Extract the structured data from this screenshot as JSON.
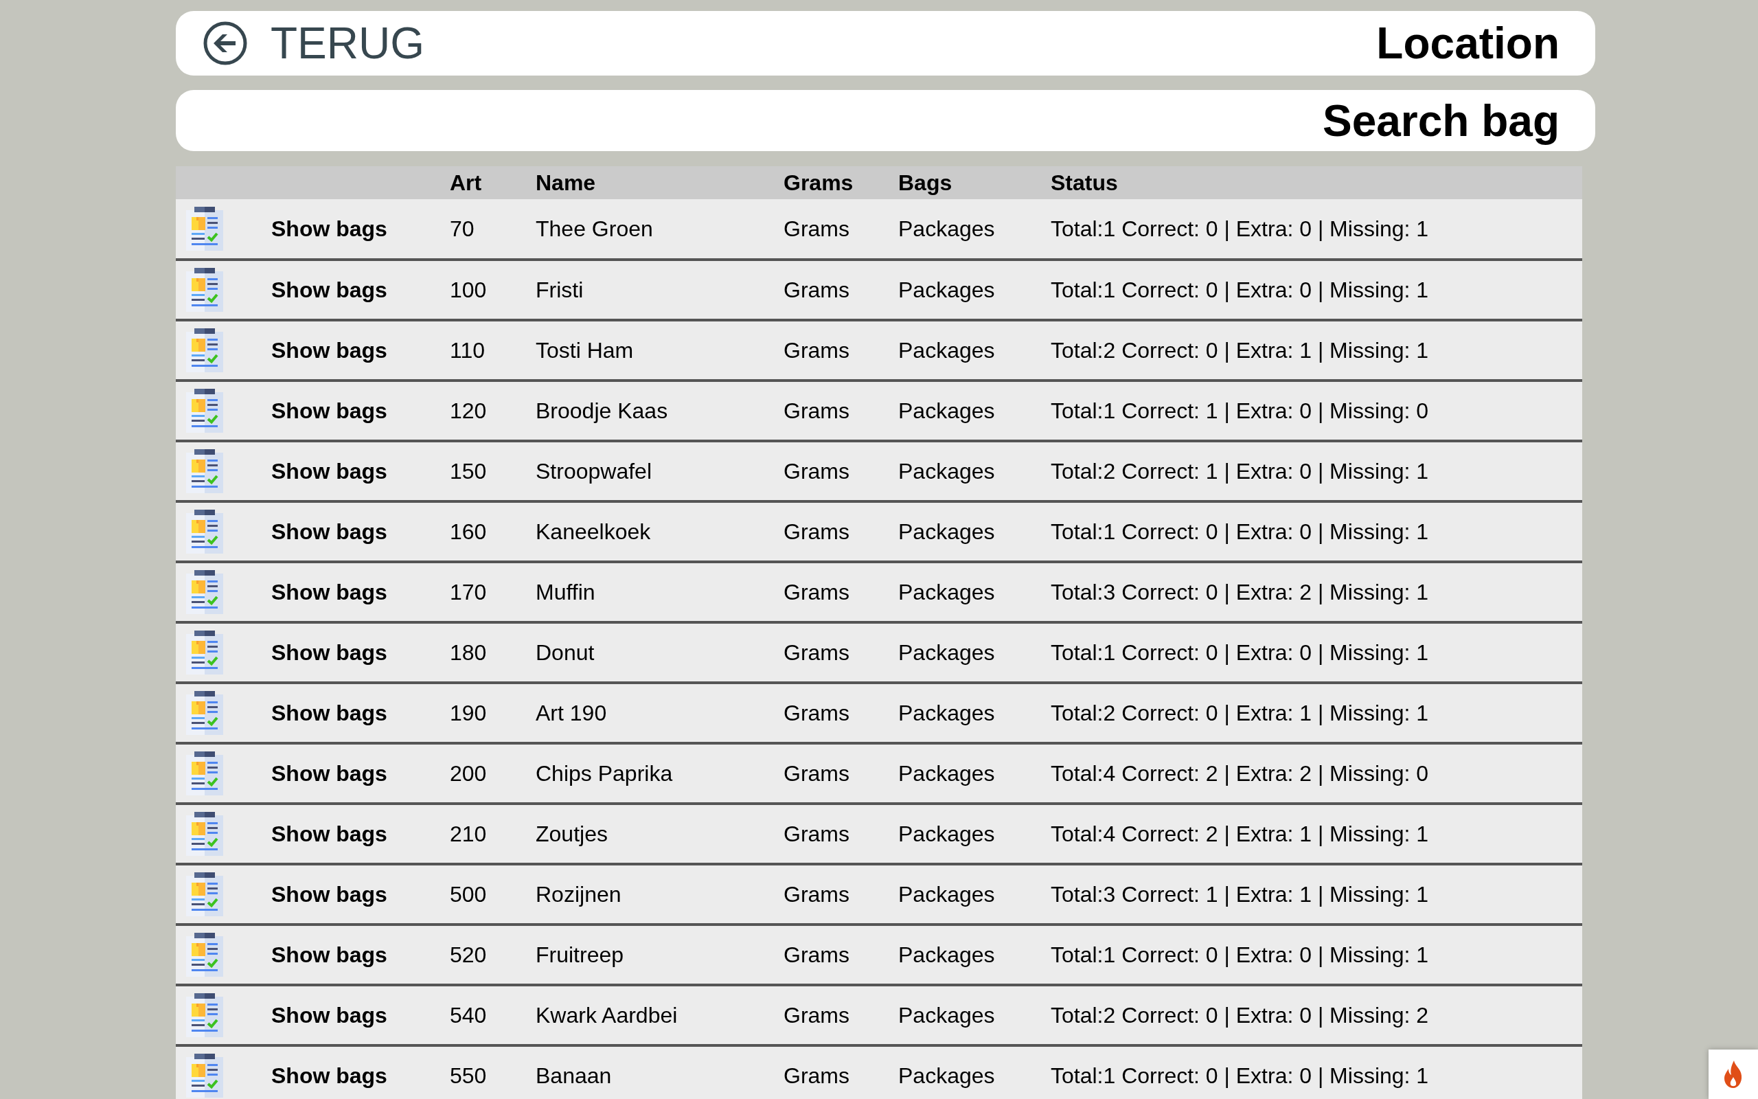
{
  "header": {
    "back_label": "TERUG",
    "title": "Location"
  },
  "subheader": {
    "title": "Search bag"
  },
  "table": {
    "columns": [
      "Art",
      "Name",
      "Grams",
      "Bags",
      "Status"
    ],
    "rows": [
      {
        "action": "Show bags",
        "art": "70",
        "name": "Thee Groen",
        "grams": "Grams",
        "bags": "Packages",
        "status": "Total:1 Correct: 0 | Extra: 0 | Missing: 1"
      },
      {
        "action": "Show bags",
        "art": "100",
        "name": "Fristi",
        "grams": "Grams",
        "bags": "Packages",
        "status": "Total:1 Correct: 0 | Extra: 0 | Missing: 1"
      },
      {
        "action": "Show bags",
        "art": "110",
        "name": "Tosti Ham",
        "grams": "Grams",
        "bags": "Packages",
        "status": "Total:2 Correct: 0 | Extra: 1 | Missing: 1"
      },
      {
        "action": "Show bags",
        "art": "120",
        "name": "Broodje Kaas",
        "grams": "Grams",
        "bags": "Packages",
        "status": "Total:1 Correct: 1 | Extra: 0 | Missing: 0"
      },
      {
        "action": "Show bags",
        "art": "150",
        "name": "Stroopwafel",
        "grams": "Grams",
        "bags": "Packages",
        "status": "Total:2 Correct: 1 | Extra: 0 | Missing: 1"
      },
      {
        "action": "Show bags",
        "art": "160",
        "name": "Kaneelkoek",
        "grams": "Grams",
        "bags": "Packages",
        "status": "Total:1 Correct: 0 | Extra: 0 | Missing: 1"
      },
      {
        "action": "Show bags",
        "art": "170",
        "name": "Muffin",
        "grams": "Grams",
        "bags": "Packages",
        "status": "Total:3 Correct: 0 | Extra: 2 | Missing: 1"
      },
      {
        "action": "Show bags",
        "art": "180",
        "name": "Donut",
        "grams": "Grams",
        "bags": "Packages",
        "status": "Total:1 Correct: 0 | Extra: 0 | Missing: 1"
      },
      {
        "action": "Show bags",
        "art": "190",
        "name": "Art 190",
        "grams": "Grams",
        "bags": "Packages",
        "status": "Total:2 Correct: 0 | Extra: 1 | Missing: 1"
      },
      {
        "action": "Show bags",
        "art": "200",
        "name": "Chips Paprika",
        "grams": "Grams",
        "bags": "Packages",
        "status": "Total:4 Correct: 2 | Extra: 2 | Missing: 0"
      },
      {
        "action": "Show bags",
        "art": "210",
        "name": "Zoutjes",
        "grams": "Grams",
        "bags": "Packages",
        "status": "Total:4 Correct: 2 | Extra: 1 | Missing: 1"
      },
      {
        "action": "Show bags",
        "art": "500",
        "name": "Rozijnen",
        "grams": "Grams",
        "bags": "Packages",
        "status": "Total:3 Correct: 1 | Extra: 1 | Missing: 1"
      },
      {
        "action": "Show bags",
        "art": "520",
        "name": "Fruitreep",
        "grams": "Grams",
        "bags": "Packages",
        "status": "Total:1 Correct: 0 | Extra: 0 | Missing: 1"
      },
      {
        "action": "Show bags",
        "art": "540",
        "name": "Kwark Aardbei",
        "grams": "Grams",
        "bags": "Packages",
        "status": "Total:2 Correct: 0 | Extra: 0 | Missing: 2"
      },
      {
        "action": "Show bags",
        "art": "550",
        "name": "Banaan",
        "grams": "Grams",
        "bags": "Packages",
        "status": "Total:1 Correct: 0 | Extra: 0 | Missing: 1"
      }
    ]
  }
}
